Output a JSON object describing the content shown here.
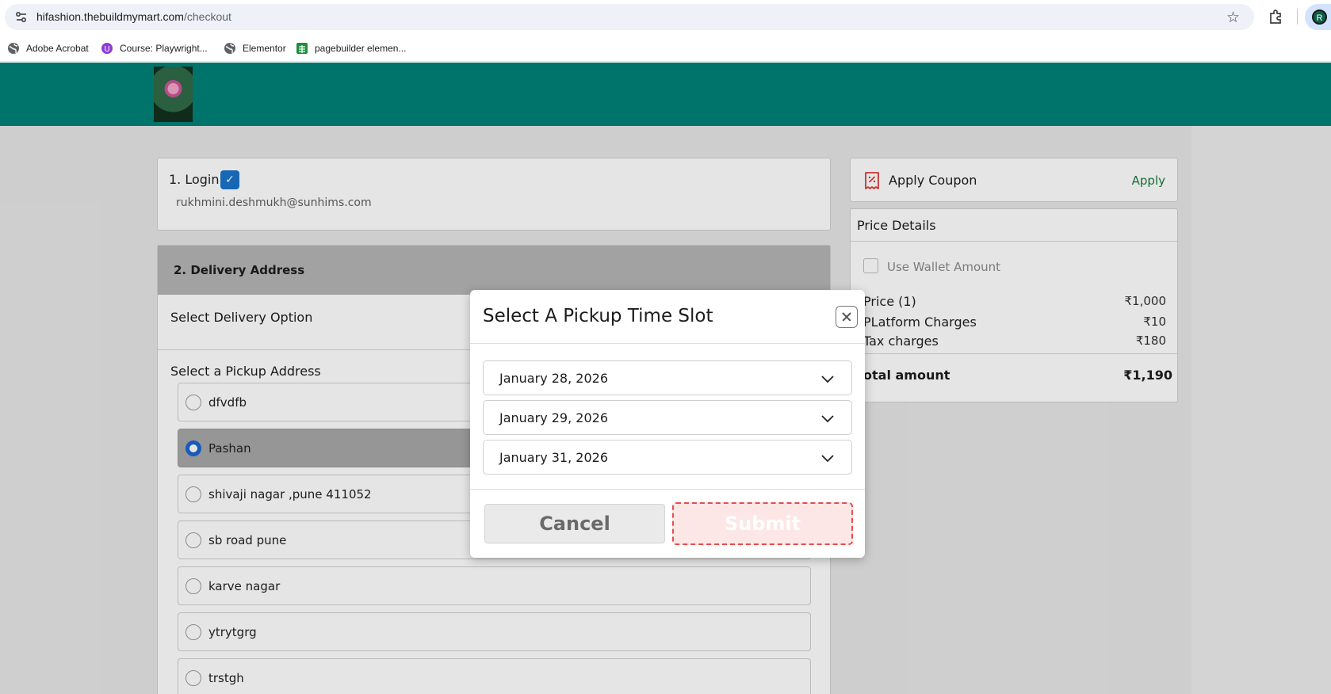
{
  "browser": {
    "url_host": "hifashion.thebuildmymart.com",
    "url_path": "/checkout",
    "profile_initial": "R",
    "bookmarks": [
      {
        "label": "Adobe Acrobat",
        "icon": "globe-icon"
      },
      {
        "label": "Course: Playwright...",
        "icon": "course-icon"
      },
      {
        "label": "Elementor",
        "icon": "globe-icon"
      },
      {
        "label": "pagebuilder elemen...",
        "icon": "sheets-icon"
      }
    ]
  },
  "colors": {
    "header": "#018076",
    "accent_blue": "#1a73c9",
    "apply_green": "#197a3c",
    "submit_border": "#e74c4c"
  },
  "login": {
    "title": "1. Login",
    "email": "rukhmini.deshmukh@sunhims.com"
  },
  "delivery": {
    "title": "2. Delivery Address",
    "option_label": "Select Delivery Option",
    "pickup_label": "Select a Pickup Address",
    "addresses": [
      {
        "name": "dfvdfb",
        "selected": false
      },
      {
        "name": "Pashan",
        "selected": true
      },
      {
        "name": "shivaji nagar ,pune 411052",
        "selected": false
      },
      {
        "name": "sb road pune",
        "selected": false
      },
      {
        "name": "karve nagar",
        "selected": false
      },
      {
        "name": "ytrytgrg",
        "selected": false
      },
      {
        "name": "trstgh",
        "selected": false
      }
    ]
  },
  "coupon": {
    "title": "Apply Coupon",
    "action": "Apply"
  },
  "price": {
    "title": "Price Details",
    "wallet_label": "Use Wallet Amount",
    "rows": [
      {
        "label": "Price (1)",
        "value": "₹1,000"
      },
      {
        "label": "PLatform Charges",
        "value": "₹10"
      },
      {
        "label": "Tax charges",
        "value": "₹180"
      }
    ],
    "total_label": "otal amount",
    "total_value": "₹1,190"
  },
  "modal": {
    "title": "Select A Pickup Time Slot",
    "dates": [
      "January 28, 2026",
      "January 29, 2026",
      "January 31, 2026"
    ],
    "cancel_label": "Cancel",
    "submit_label": "Submit"
  }
}
